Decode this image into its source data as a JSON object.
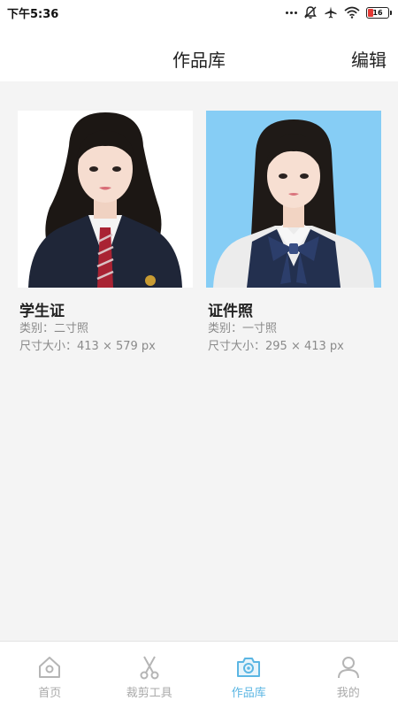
{
  "status_bar": {
    "time": "下午5:36",
    "battery": "16"
  },
  "header": {
    "title": "作品库",
    "edit_label": "编辑"
  },
  "works": [
    {
      "title": "学生证",
      "category": "类别：二寸照",
      "size": "尺寸大小：413 × 579 px",
      "background": "#ffffff"
    },
    {
      "title": "证件照",
      "category": "类别：一寸照",
      "size": "尺寸大小：295 × 413 px",
      "background": "#86cdf5"
    }
  ],
  "tabs": [
    {
      "label": "首页",
      "icon": "home-icon",
      "active": false
    },
    {
      "label": "裁剪工具",
      "icon": "scissors-icon",
      "active": false
    },
    {
      "label": "作品库",
      "icon": "camera-icon",
      "active": true
    },
    {
      "label": "我的",
      "icon": "person-icon",
      "active": false
    }
  ],
  "colors": {
    "accent": "#5bb6e3",
    "inactive": "#aaaaaa",
    "page_bg": "#f4f4f4"
  }
}
